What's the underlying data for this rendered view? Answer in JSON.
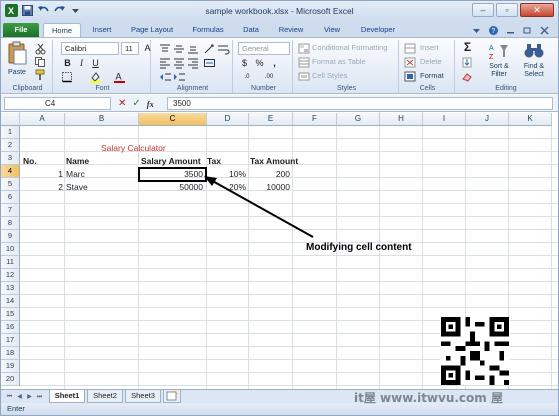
{
  "window": {
    "title": "sample workbook.xlsx  -  Microsoft Excel",
    "controls": [
      "–",
      "▫",
      "✕"
    ]
  },
  "ribbon_tabs": [
    "File",
    "Home",
    "Insert",
    "Page Layout",
    "Formulas",
    "Data",
    "Review",
    "View",
    "Developer"
  ],
  "ribbon": {
    "clipboard": {
      "label": "Clipboard",
      "paste": "Paste"
    },
    "font": {
      "label": "Font",
      "font_name": "Calibri",
      "font_size": "11",
      "bold": "B",
      "italic": "I",
      "underline": "U",
      "grow": "A",
      "shrink": "A"
    },
    "alignment": {
      "label": "Alignment"
    },
    "number": {
      "label": "Number",
      "format": "General",
      "currency": "$",
      "percent": "%",
      "comma": ",",
      "inc_decimal": ".0",
      "dec_decimal": ".00"
    },
    "styles": {
      "label": "Styles",
      "conditional": "Conditional Formatting",
      "format_table": "Format as Table",
      "cell_styles": "Cell Styles"
    },
    "cells": {
      "label": "Cells",
      "insert": "Insert",
      "delete": "Delete",
      "format": "Format"
    },
    "editing": {
      "label": "Editing",
      "sum": "Σ",
      "sort": "Sort &",
      "filter": "Filter",
      "find": "Find &",
      "select": "Select"
    }
  },
  "formula_bar": {
    "name_box": "C4",
    "fx": "fx",
    "value": "3500"
  },
  "columns": [
    "A",
    "B",
    "C",
    "D",
    "E",
    "F",
    "G",
    "H",
    "I",
    "J",
    "K"
  ],
  "rows": [
    "1",
    "2",
    "3",
    "4",
    "5",
    "6",
    "7",
    "8",
    "9",
    "10",
    "11",
    "12",
    "13",
    "14",
    "15",
    "16",
    "17",
    "18",
    "19",
    "20"
  ],
  "sheet": {
    "title": "Salary Calculator",
    "headers": {
      "no": "No.",
      "name": "Name",
      "salary": "Salary Amount",
      "tax": "Tax",
      "tax_amount": "Tax Amount"
    },
    "records": [
      {
        "no": "1",
        "name": "Marc",
        "salary": "3500",
        "tax": "10%",
        "tax_amount": "200"
      },
      {
        "no": "2",
        "name": "Stave",
        "salary": "50000",
        "tax": "20%",
        "tax_amount": "10000"
      }
    ]
  },
  "annotation": "Modifying cell content",
  "sheet_tabs": [
    "Sheet1",
    "Sheet2",
    "Sheet3"
  ],
  "status": {
    "mode": "Enter"
  },
  "watermark": "it屋 www.itwvu.com 屋"
}
